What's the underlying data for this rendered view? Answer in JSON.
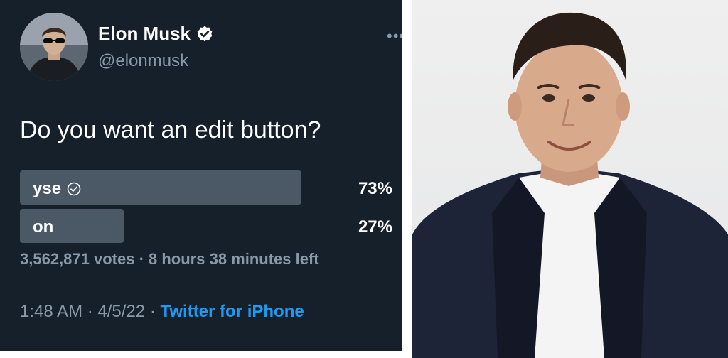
{
  "tweet": {
    "name": "Elon Musk",
    "handle": "@elonmusk",
    "more_icon": "more-dots-icon",
    "verified_icon": "verified-badge-icon",
    "text": "Do you want an edit button?",
    "poll": {
      "options": [
        {
          "label": "yse",
          "percent_text": "73%",
          "percent": 73,
          "selected": true
        },
        {
          "label": "on",
          "percent_text": "27%",
          "percent": 27,
          "selected": false
        }
      ],
      "meta": "3,562,871 votes · 8 hours 38 minutes left"
    },
    "time": "1:48 AM",
    "date": "4/5/22",
    "client": "Twitter for iPhone"
  },
  "colors": {
    "background": "#15202b",
    "text": "#ffffff",
    "muted": "#8b98a5",
    "poll_bar": "#4b5966",
    "link": "#1d9bf0"
  }
}
